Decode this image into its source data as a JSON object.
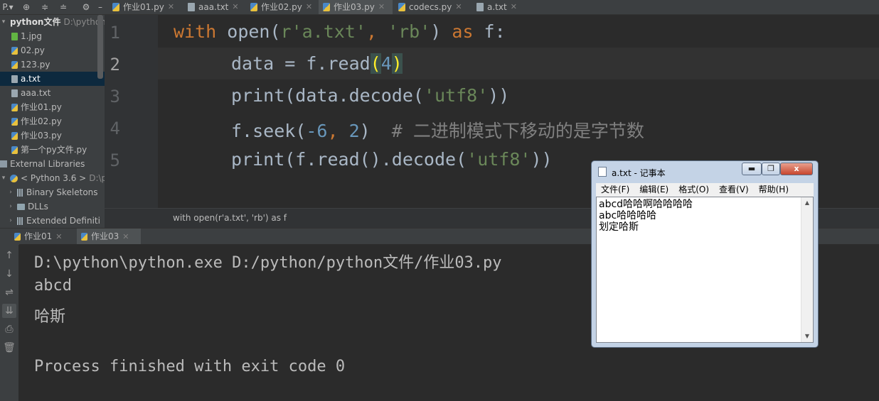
{
  "toolbar": {
    "project_menu": "P.▾",
    "locate": "⊕",
    "collapse": "≑",
    "expand": "≐",
    "settings": "⚙",
    "hide": "–"
  },
  "tabs": [
    {
      "label": "作业01.py",
      "icon": "python-file-icon"
    },
    {
      "label": "aaa.txt",
      "icon": "text-file-icon"
    },
    {
      "label": "作业02.py",
      "icon": "python-file-icon"
    },
    {
      "label": "作业03.py",
      "icon": "python-file-icon",
      "active": true
    },
    {
      "label": "codecs.py",
      "icon": "python-file-icon"
    },
    {
      "label": "a.txt",
      "icon": "text-file-icon"
    }
  ],
  "project": {
    "root_label": "python文件",
    "root_path": "D:\\python\\",
    "files": [
      "1.jpg",
      "02.py",
      "123.py",
      "a.txt",
      "aaa.txt",
      "作业01.py",
      "作业02.py",
      "作业03.py",
      "第一个py文件.py"
    ],
    "external_libraries": "External Libraries",
    "sdk_label": "< Python 3.6 >",
    "sdk_path": "D:\\p",
    "sdk_children": [
      "Binary Skeletons",
      "DLLs",
      "Extended Definiti"
    ]
  },
  "editor": {
    "line_numbers": [
      "1",
      "2",
      "3",
      "4",
      "5"
    ],
    "code": {
      "l1_kw1": "with",
      "l1_mid": " open(",
      "l1_str1": "r'a.txt'",
      "l1_comma": ", ",
      "l1_str2": "'rb'",
      "l1_close": ") ",
      "l1_kw2": "as",
      "l1_end": " f:",
      "l2_pre": "data = f.read",
      "l2_open": "(",
      "l2_num": "4",
      "l2_close": ")",
      "l3_pre": "print(data.decode(",
      "l3_str": "'utf8'",
      "l3_end": "))",
      "l4_pre": "f.seek(",
      "l4_num1": "-6",
      "l4_comma": ", ",
      "l4_num2": "2",
      "l4_close": ")  ",
      "l4_cmt": "# 二进制模式下移动的是字节数",
      "l5_pre": "print(f.read().decode(",
      "l5_str": "'utf8'",
      "l5_end": "))"
    }
  },
  "breadcrumb": "with open(r'a.txt', 'rb') as f",
  "run": {
    "tabs": [
      "作业01",
      "作业03"
    ],
    "active_tab": "作业03",
    "output": [
      "D:\\python\\python.exe D:/python/python文件/作业03.py",
      "abcd",
      "哈斯",
      "",
      "Process finished with exit code 0"
    ]
  },
  "notepad": {
    "title": "a.txt - 记事本",
    "minimize": "▬",
    "maximize": "❐",
    "close": "x",
    "menu": [
      "文件(F)",
      "编辑(E)",
      "格式(O)",
      "查看(V)",
      "帮助(H)"
    ],
    "content": [
      "abcd哈哈啊哈哈哈哈",
      "abc哈哈哈哈",
      "划定哈斯"
    ]
  }
}
